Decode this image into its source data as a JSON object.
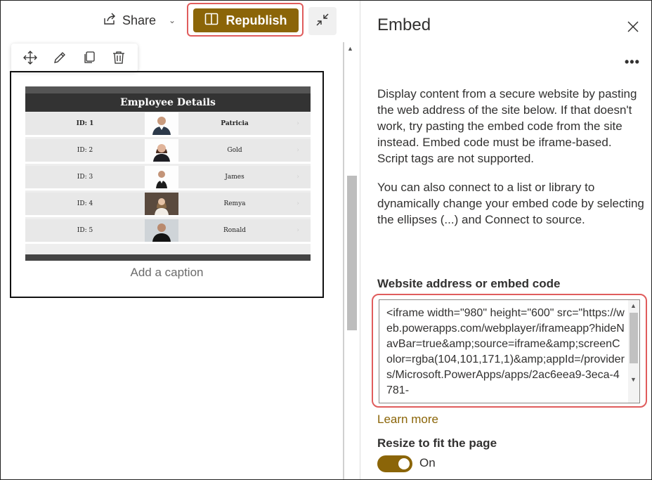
{
  "toolbar": {
    "share_label": "Share",
    "republish_label": "Republish"
  },
  "app": {
    "title": "Employee Details",
    "employees": [
      {
        "id": "ID: 1",
        "name": "Patricia"
      },
      {
        "id": "ID: 2",
        "name": "Gold"
      },
      {
        "id": "ID: 3",
        "name": "James"
      },
      {
        "id": "ID: 4",
        "name": "Remya"
      },
      {
        "id": "ID: 5",
        "name": "Ronald"
      }
    ]
  },
  "caption_placeholder": "Add a caption",
  "panel": {
    "title": "Embed",
    "description_1": "Display content from a secure website by pasting the web address of the site below. If that doesn't work, try pasting the embed code from the site instead. Embed code must be iframe-based. Script tags are not supported.",
    "description_2": "You can also connect to a list or library to dynamically change your embed code by selecting the ellipses (...) and Connect to source.",
    "field_label": "Website address or embed code",
    "embed_code": "<iframe width=\"980\" height=\"600\" src=\"https://web.powerapps.com/webplayer/iframeapp?hideNavBar=true&amp;source=iframe&amp;screenColor=rgba(104,101,171,1)&amp;appId=/providers/Microsoft.PowerApps/apps/2ac6eea9-3eca-4781-",
    "learn_more": "Learn more",
    "resize_label": "Resize to fit the page",
    "resize_state": "On"
  },
  "colors": {
    "accent": "#8b6508",
    "highlight_outline": "#e05c5c"
  }
}
